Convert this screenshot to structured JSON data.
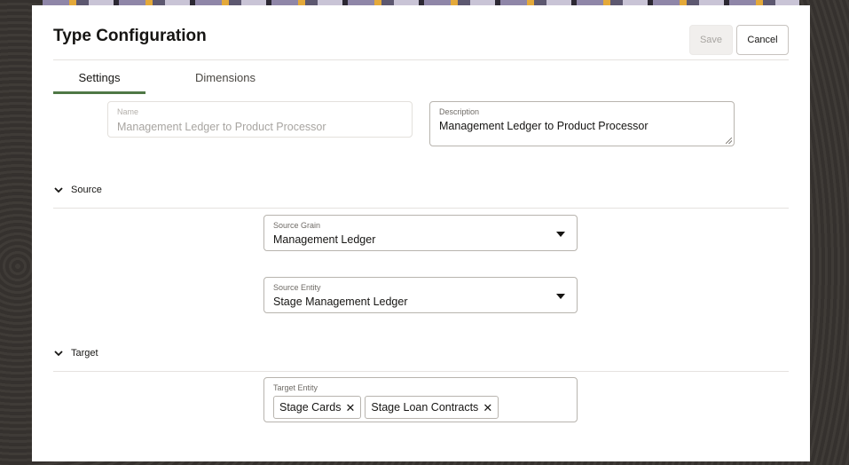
{
  "dialog": {
    "title": "Type Configuration",
    "save_label": "Save",
    "cancel_label": "Cancel"
  },
  "tabs": [
    {
      "label": "Settings",
      "selected": true
    },
    {
      "label": "Dimensions",
      "selected": false
    }
  ],
  "settings": {
    "name_label": "Name",
    "name_value": "Management Ledger to Product Processor",
    "description_label": "Description",
    "description_value": "Management Ledger to Product Processor"
  },
  "source": {
    "section_label": "Source",
    "grain_label": "Source Grain",
    "grain_value": "Management Ledger",
    "entity_label": "Source Entity",
    "entity_value": "Stage Management Ledger"
  },
  "target": {
    "section_label": "Target",
    "entity_label": "Target Entity",
    "chips": [
      "Stage Cards",
      "Stage Loan Contracts"
    ]
  },
  "icons": {
    "section_toggle": "chevron-down-icon",
    "select_caret": "caret-down-icon",
    "chip_remove": "close-icon",
    "chip_remove_glyph": "✕"
  },
  "colors": {
    "accent_tab": "#4f7845",
    "background": "#3a3633"
  }
}
